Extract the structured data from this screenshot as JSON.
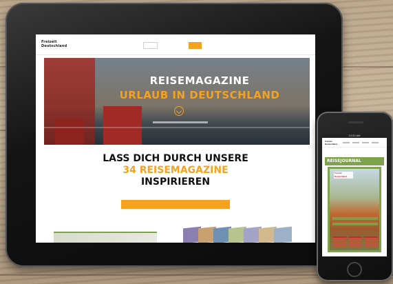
{
  "tablet": {
    "logo": "Freizeit Deutschland",
    "nav_items": [
      "",
      "",
      "",
      "",
      "",
      "",
      ""
    ],
    "nav_cta": "",
    "hero": {
      "title": "REISEMAGAZINE",
      "subtitle": "URLAUB IN DEUTSCHLAND"
    },
    "pitch": {
      "line1": "LASS DICH DURCH UNSERE",
      "line2": "34 REISEMAGAZINE",
      "line3": "INSPIRIEREN"
    },
    "colors": {
      "accent": "#f4a21f",
      "green": "#7ea34a",
      "hero_red": "#a22a24"
    }
  },
  "phone": {
    "status_time": "13:20 AM",
    "logo": "Freizeit Deutschland",
    "journal_title": "REISEJOURNAL SACHSEN",
    "cover_logo": "Freizeit Deutschland"
  },
  "icons": [
    "hero-arrow-down-icon",
    "phone-home-button-icon"
  ]
}
